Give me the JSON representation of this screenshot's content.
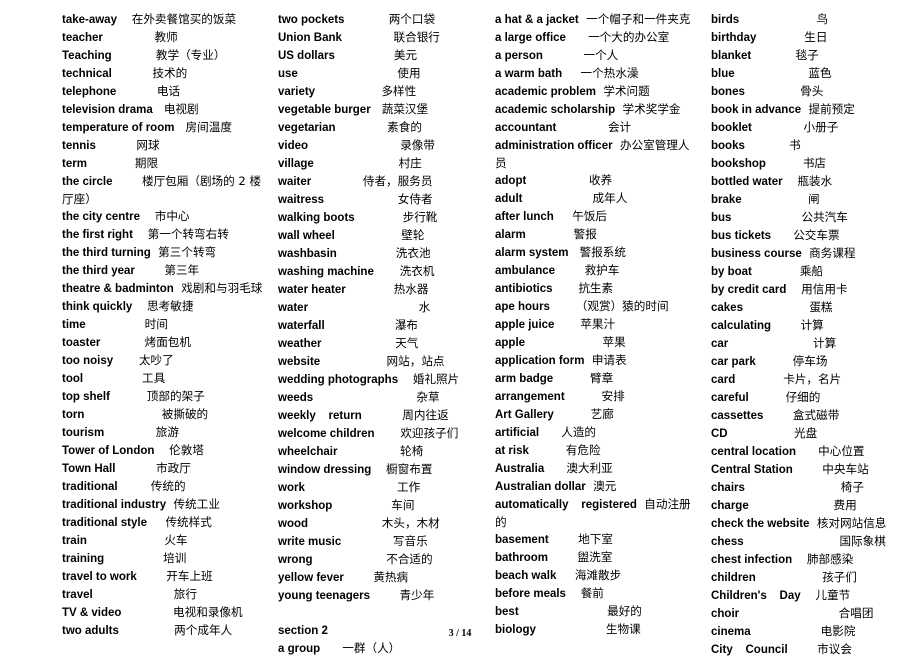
{
  "columns": [
    [
      {
        "en": "take-away",
        "gap": "    ",
        "zh": "在外卖餐馆买的饭菜"
      },
      {
        "en": "teacher",
        "gap": "              ",
        "zh": "教师"
      },
      {
        "en": "Teaching",
        "gap": "            ",
        "zh": "教学（专业）"
      },
      {
        "en": "technical",
        "gap": "           ",
        "zh": "技术的"
      },
      {
        "en": "telephone",
        "gap": "           ",
        "zh": "电话"
      },
      {
        "en": "television drama",
        "gap": "   ",
        "zh": "电视剧"
      },
      {
        "en": "temperature of room",
        "gap": "   ",
        "zh": "房间温度"
      },
      {
        "en": "tennis",
        "gap": "           ",
        "zh": "网球"
      },
      {
        "en": "term",
        "gap": "             ",
        "zh": "期限"
      },
      {
        "en": "the circle",
        "gap": "        ",
        "zh": "楼厅包厢（剧场的 2 楼厅座）"
      },
      {
        "en": "the city centre",
        "gap": "    ",
        "zh": "市中心"
      },
      {
        "en": "the first right",
        "gap": "    ",
        "zh": "第一个转弯右转"
      },
      {
        "en": "the third turning",
        "gap": "  ",
        "zh": "第三个转弯"
      },
      {
        "en": "the third year",
        "gap": "        ",
        "zh": "第三年"
      },
      {
        "en": "theatre & badminton",
        "gap": "  ",
        "zh": "戏剧和与羽毛球"
      },
      {
        "en": "think quickly",
        "gap": "    ",
        "zh": "思考敏捷"
      },
      {
        "en": "time",
        "gap": "                ",
        "zh": "时间"
      },
      {
        "en": "toaster",
        "gap": "            ",
        "zh": "烤面包机"
      },
      {
        "en": "too noisy",
        "gap": "       ",
        "zh": "太吵了"
      },
      {
        "en": "tool",
        "gap": "                ",
        "zh": "工具"
      },
      {
        "en": "top shelf",
        "gap": "          ",
        "zh": "顶部的架子"
      },
      {
        "en": "torn",
        "gap": "                     ",
        "zh": "被撕破的"
      },
      {
        "en": "tourism",
        "gap": "              ",
        "zh": "旅游"
      },
      {
        "en": "Tower of London",
        "gap": "    ",
        "zh": "伦敦塔"
      },
      {
        "en": "Town Hall",
        "gap": "           ",
        "zh": "市政厅"
      },
      {
        "en": "traditional",
        "gap": "         ",
        "zh": "传统的"
      },
      {
        "en": "traditional industry",
        "gap": "  ",
        "zh": "传统工业"
      },
      {
        "en": "traditional style",
        "gap": "     ",
        "zh": "传统样式"
      },
      {
        "en": "train",
        "gap": "                     ",
        "zh": "火车"
      },
      {
        "en": "training",
        "gap": "                ",
        "zh": "培训"
      },
      {
        "en": "travel to work",
        "gap": "        ",
        "zh": "开车上班"
      },
      {
        "en": "travel",
        "gap": "                      ",
        "zh": "旅行"
      },
      {
        "en": "TV & video",
        "gap": "              ",
        "zh": "电视和录像机"
      },
      {
        "en": "two adults",
        "gap": "               ",
        "zh": "两个成年人"
      }
    ],
    [
      {
        "en": "two pockets",
        "gap": "            ",
        "zh": "两个口袋"
      },
      {
        "en": "Union Bank",
        "gap": "              ",
        "zh": "联合银行"
      },
      {
        "en": "US dollars",
        "gap": "                ",
        "zh": "美元"
      },
      {
        "en": "use",
        "gap": "                           ",
        "zh": "使用"
      },
      {
        "en": "variety",
        "gap": "                  ",
        "zh": "多样性"
      },
      {
        "en": "vegetable burger",
        "gap": "   ",
        "zh": "蔬菜汉堡"
      },
      {
        "en": "vegetarian",
        "gap": "              ",
        "zh": "素食的"
      },
      {
        "en": "video",
        "gap": "                         ",
        "zh": "录像带"
      },
      {
        "en": "village",
        "gap": "                       ",
        "zh": "村庄"
      },
      {
        "en": "waiter",
        "gap": "              ",
        "zh": "侍者，服务员"
      },
      {
        "en": "waitress",
        "gap": "                    ",
        "zh": "女侍者"
      },
      {
        "en": "walking boots",
        "gap": "             ",
        "zh": "步行靴"
      },
      {
        "en": "wall wheel",
        "gap": "                  ",
        "zh": "壁轮"
      },
      {
        "en": "washbasin",
        "gap": "                ",
        "zh": "洗衣池"
      },
      {
        "en": "washing machine",
        "gap": "       ",
        "zh": "洗衣机"
      },
      {
        "en": "water heater",
        "gap": "             ",
        "zh": "热水器"
      },
      {
        "en": "water",
        "gap": "                              ",
        "zh": "水"
      },
      {
        "en": "waterfall",
        "gap": "                   ",
        "zh": "瀑布"
      },
      {
        "en": "weather",
        "gap": "                    ",
        "zh": "天气"
      },
      {
        "en": "website",
        "gap": "                  ",
        "zh": "网站，站点"
      },
      {
        "en": "wedding photographs",
        "gap": "    ",
        "zh": "婚礼照片"
      },
      {
        "en": "weeds",
        "gap": "                            ",
        "zh": "杂草"
      },
      {
        "en": "weekly    return",
        "gap": "           ",
        "zh": "周内往返"
      },
      {
        "en": "welcome children",
        "gap": "       ",
        "zh": "欢迎孩子们"
      },
      {
        "en": "wheelchair",
        "gap": "                 ",
        "zh": "轮椅"
      },
      {
        "en": "window dressing",
        "gap": "    ",
        "zh": "橱窗布置"
      },
      {
        "en": "work",
        "gap": "                         ",
        "zh": "工作"
      },
      {
        "en": "workshop",
        "gap": "                ",
        "zh": "车间"
      },
      {
        "en": "wood",
        "gap": "                    ",
        "zh": "木头，木材"
      },
      {
        "en": "write music",
        "gap": "              ",
        "zh": "写音乐"
      },
      {
        "en": "wrong",
        "gap": "                    ",
        "zh": "不合适的"
      },
      {
        "en": "yellow fever",
        "gap": "        ",
        "zh": "黄热病"
      },
      {
        "en": "young teenagers",
        "gap": "        ",
        "zh": "青少年"
      },
      {
        "blank": true
      },
      {
        "en": "section 2",
        "gap": "",
        "zh": ""
      },
      {
        "en": "a group",
        "gap": "      ",
        "zh": "一群（人）"
      }
    ],
    [
      {
        "en": "a hat & a jacket",
        "gap": "  ",
        "zh": "一个帽子和一件夹克"
      },
      {
        "en": "a large office",
        "gap": "      ",
        "zh": "一个大的办公室"
      },
      {
        "en": "a person",
        "gap": "           ",
        "zh": "一个人"
      },
      {
        "en": "a warm bath",
        "gap": "     ",
        "zh": "一个热水澡"
      },
      {
        "en": "academic problem",
        "gap": "  ",
        "zh": "学术问题"
      },
      {
        "en": "academic scholarship",
        "gap": "  ",
        "zh": "学术奖学金"
      },
      {
        "en": "accountant",
        "gap": "              ",
        "zh": "会计"
      },
      {
        "en": "administration officer",
        "gap": "  ",
        "zh": "办公室管理人员"
      },
      {
        "en": "adopt",
        "gap": "                 ",
        "zh": "收养"
      },
      {
        "en": "adult",
        "gap": "                   ",
        "zh": "成年人"
      },
      {
        "en": "after lunch",
        "gap": "     ",
        "zh": "午饭后"
      },
      {
        "en": "alarm",
        "gap": "             ",
        "zh": "警报"
      },
      {
        "en": "alarm system",
        "gap": "   ",
        "zh": "警报系统"
      },
      {
        "en": "ambulance",
        "gap": "        ",
        "zh": "救护车"
      },
      {
        "en": "antibiotics",
        "gap": "       ",
        "zh": "抗生素"
      },
      {
        "en": "ape hours",
        "gap": "       ",
        "zh": "（观赏）猿的时间"
      },
      {
        "en": "apple juice",
        "gap": "       ",
        "zh": "苹果汁"
      },
      {
        "en": "apple",
        "gap": "                     ",
        "zh": "苹果"
      },
      {
        "en": "application form",
        "gap": "  ",
        "zh": "申请表"
      },
      {
        "en": "arm badge",
        "gap": "          ",
        "zh": "臂章"
      },
      {
        "en": "arrangement",
        "gap": "          ",
        "zh": "安排"
      },
      {
        "en": "Art Gallery",
        "gap": "          ",
        "zh": "艺廊"
      },
      {
        "en": "artificial",
        "gap": "      ",
        "zh": "人造的"
      },
      {
        "en": "at risk",
        "gap": "          ",
        "zh": "有危险"
      },
      {
        "en": "Australia",
        "gap": "      ",
        "zh": "澳大利亚"
      },
      {
        "en": "Australian dollar",
        "gap": "  ",
        "zh": "澳元"
      },
      {
        "en": "automatically    registered",
        "gap": "  ",
        "zh": "自动注册的"
      },
      {
        "en": "basement",
        "gap": "        ",
        "zh": "地下室"
      },
      {
        "en": "bathroom",
        "gap": "        ",
        "zh": "盥洗室"
      },
      {
        "en": "beach walk",
        "gap": "     ",
        "zh": "海滩散步"
      },
      {
        "en": "before meals",
        "gap": "    ",
        "zh": "餐前"
      },
      {
        "en": "best",
        "gap": "                        ",
        "zh": "最好的"
      },
      {
        "en": "biology",
        "gap": "                   ",
        "zh": "生物课"
      }
    ],
    [
      {
        "en": "birds",
        "gap": "                     ",
        "zh": "鸟"
      },
      {
        "en": "birthday",
        "gap": "             ",
        "zh": "生日"
      },
      {
        "en": "blanket",
        "gap": "            ",
        "zh": "毯子"
      },
      {
        "en": "blue",
        "gap": "                    ",
        "zh": "蓝色"
      },
      {
        "en": "bones",
        "gap": "               ",
        "zh": "骨头"
      },
      {
        "en": "book in advance",
        "gap": "  ",
        "zh": "提前预定"
      },
      {
        "en": "booklet",
        "gap": "              ",
        "zh": "小册子"
      },
      {
        "en": "books",
        "gap": "            ",
        "zh": "书"
      },
      {
        "en": "bookshop",
        "gap": "          ",
        "zh": "书店"
      },
      {
        "en": "bottled water",
        "gap": "    ",
        "zh": "瓶装水"
      },
      {
        "en": "brake",
        "gap": "                  ",
        "zh": "闸"
      },
      {
        "en": "bus",
        "gap": "                   ",
        "zh": "公共汽车"
      },
      {
        "en": "bus tickets",
        "gap": "      ",
        "zh": "公交车票"
      },
      {
        "en": "business course",
        "gap": "  ",
        "zh": "商务课程"
      },
      {
        "en": "by boat",
        "gap": "             ",
        "zh": "乘船"
      },
      {
        "en": "by credit card",
        "gap": "    ",
        "zh": "用信用卡"
      },
      {
        "en": "cakes",
        "gap": "                  ",
        "zh": "蛋糕"
      },
      {
        "en": "calculating",
        "gap": "        ",
        "zh": "计算"
      },
      {
        "en": "car",
        "gap": "                       ",
        "zh": "计算"
      },
      {
        "en": "car park",
        "gap": "          ",
        "zh": "停车场"
      },
      {
        "en": "card",
        "gap": "             ",
        "zh": "卡片，名片"
      },
      {
        "en": "careful",
        "gap": "          ",
        "zh": "仔细的"
      },
      {
        "en": "cassettes",
        "gap": "        ",
        "zh": "盒式磁带"
      },
      {
        "en": "CD",
        "gap": "                  ",
        "zh": "光盘"
      },
      {
        "en": "central location",
        "gap": "      ",
        "zh": "中心位置"
      },
      {
        "en": "Central Station",
        "gap": "        ",
        "zh": "中央车站"
      },
      {
        "en": "chairs",
        "gap": "                          ",
        "zh": "椅子"
      },
      {
        "en": "charge",
        "gap": "                       ",
        "zh": "费用"
      },
      {
        "en": "check the website",
        "gap": "  ",
        "zh": "核对网站信息"
      },
      {
        "en": "chess",
        "gap": "                          ",
        "zh": "国际象棋"
      },
      {
        "en": "chest infection",
        "gap": "    ",
        "zh": "肺部感染"
      },
      {
        "en": "children",
        "gap": "                  ",
        "zh": "孩子们"
      },
      {
        "en": "Children's    Day",
        "gap": "    ",
        "zh": "儿童节"
      },
      {
        "en": "choir",
        "gap": "                           ",
        "zh": "合唱团"
      },
      {
        "en": "cinema",
        "gap": "                   ",
        "zh": "电影院"
      },
      {
        "en": "City    Council",
        "gap": "        ",
        "zh": "市议会"
      }
    ]
  ],
  "footer": {
    "page_number": "3 / 14"
  }
}
